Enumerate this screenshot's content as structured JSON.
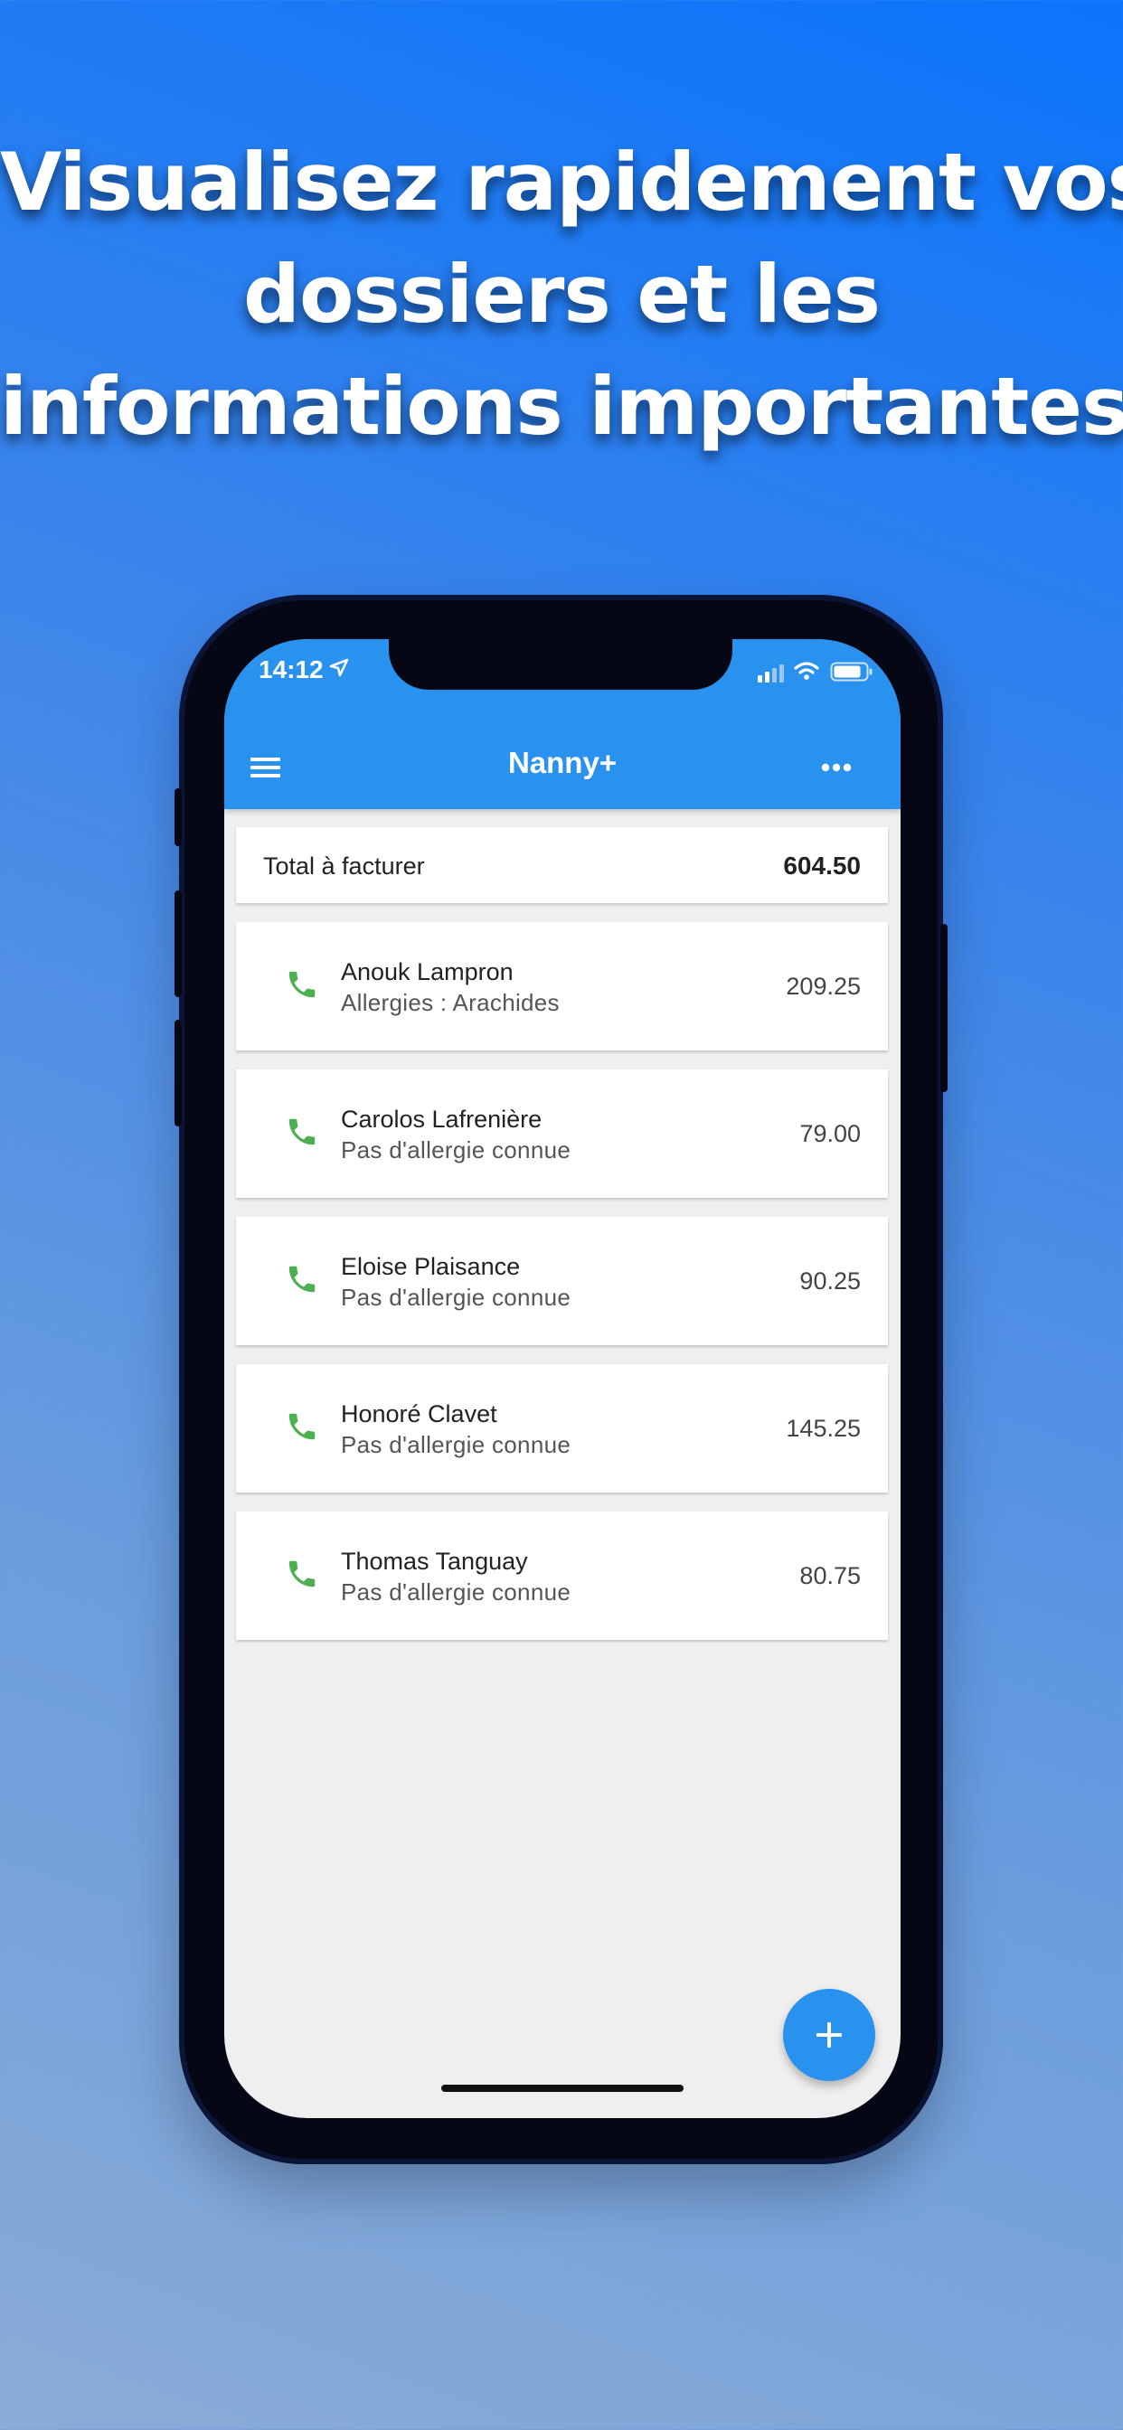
{
  "headline": {
    "line1": "Visualisez rapidement vos",
    "line2": "dossiers et les",
    "line3": "informations importantes"
  },
  "status_bar": {
    "time": "14:12"
  },
  "app_bar": {
    "title": "Nanny+",
    "menu_icon": "hamburger-menu-icon",
    "more_icon": "more-horizontal-icon"
  },
  "summary": {
    "label": "Total à facturer",
    "value": "604.50"
  },
  "children": [
    {
      "name": "Anouk Lampron",
      "allergy": "Allergies : Arachides",
      "amount": "209.25"
    },
    {
      "name": "Carolos Lafrenière",
      "allergy": "Pas d'allergie connue",
      "amount": "79.00"
    },
    {
      "name": "Eloise Plaisance",
      "allergy": "Pas d'allergie connue",
      "amount": "90.25"
    },
    {
      "name": "Honoré Clavet",
      "allergy": "Pas d'allergie connue",
      "amount": "145.25"
    },
    {
      "name": "Thomas Tanguay",
      "allergy": "Pas d'allergie connue",
      "amount": "80.75"
    }
  ],
  "colors": {
    "accent": "#2992ee",
    "phone_icon": "#4caf50",
    "list_background": "#efefef"
  }
}
